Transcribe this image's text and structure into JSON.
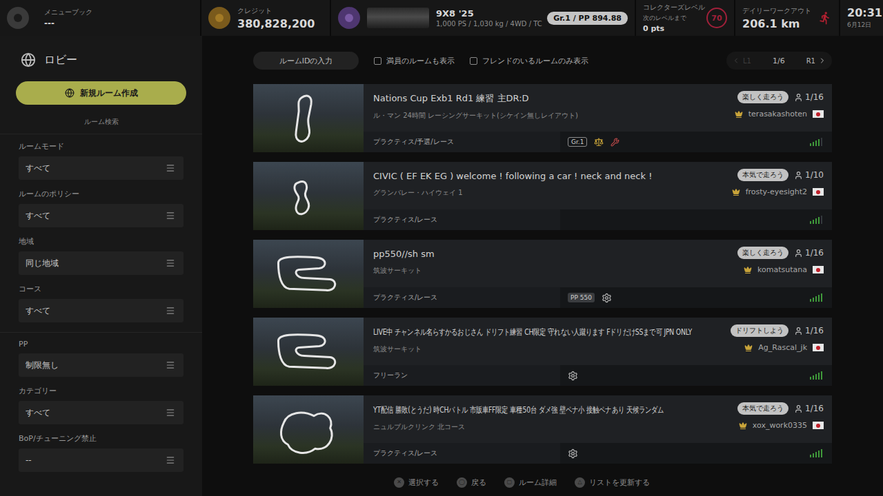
{
  "topbar": {
    "menu_book": {
      "label": "メニューブック",
      "value": "---"
    },
    "credits": {
      "label": "クレジット",
      "value": "380,828,200"
    },
    "car": {
      "name": "9X8 '25",
      "specs": "1,000 PS / 1,030 kg / 4WD / TC",
      "badge": "Gr.1 / PP 894.88"
    },
    "collector": {
      "label": "コレクターズレベル",
      "sublabel": "次のレベルまで",
      "points": "0 pts",
      "level": "70"
    },
    "workout": {
      "label": "デイリーワークアウト",
      "value": "206.1 km"
    },
    "clock": {
      "time": "20:31",
      "date": "6月12日"
    }
  },
  "sidebar": {
    "title": "ロビー",
    "create_button": "新規ルーム作成",
    "search_title": "ルーム検索",
    "filter_groups": [
      [
        {
          "label": "ルームモード",
          "value": "すべて"
        },
        {
          "label": "ルームのポリシー",
          "value": "すべて"
        },
        {
          "label": "地域",
          "value": "同じ地域"
        },
        {
          "label": "コース",
          "value": "すべて"
        }
      ],
      [
        {
          "label": "PP",
          "value": "制限無し"
        },
        {
          "label": "カテゴリー",
          "value": "すべて"
        },
        {
          "label": "BoP/チューニング禁止",
          "value": "--"
        }
      ]
    ]
  },
  "toolbar": {
    "room_id_button": "ルームIDの入力",
    "checkboxes": [
      {
        "label": "満員のルームも表示",
        "checked": false
      },
      {
        "label": "フレンドのいるルームのみ表示",
        "checked": false
      }
    ],
    "pager": {
      "prev": "L1",
      "prev_disabled": true,
      "page": "1/6",
      "next": "R1"
    }
  },
  "rooms": [
    {
      "title": "Nations Cup Exb1 Rd1 練習 主DR:D",
      "course": "ル・マン 24時間 レーシングサーキット(シケイン無しレイアウト)",
      "mode": "プラクティス/予選/レース",
      "policy": "楽しく走ろう",
      "players": "1/16",
      "host": "terasakashoten",
      "signal_bars": 4,
      "tags": [
        {
          "kind": "class-badge",
          "label": "Gr.1"
        },
        {
          "kind": "bop"
        },
        {
          "kind": "no-tuning"
        }
      ]
    },
    {
      "title": "CIVIC ( EF EK EG ) welcome ! following a car ! neck and neck !",
      "course": "グランバレー・ハイウェイ 1",
      "mode": "プラクティス/レース",
      "policy": "本気で走ろう",
      "players": "1/10",
      "host": "frosty-eyesight2",
      "signal_bars": 4,
      "tags": []
    },
    {
      "title": "pp550//sh  sm",
      "course": "筑波サーキット",
      "mode": "プラクティス/レース",
      "policy": "楽しく走ろう",
      "players": "1/16",
      "host": "komatsutana",
      "signal_bars": 5,
      "tags": [
        {
          "kind": "pp-badge",
          "label": "PP 550"
        },
        {
          "kind": "settings"
        }
      ]
    },
    {
      "title": "LIVE中 チャンネル名らすかるおじさん ドリフト練習 CH限定 守れない人蹴ります FドリだけSSまで可 JPN ONLY",
      "course": "筑波サーキット",
      "mode": "フリーラン",
      "policy": "ドリフトしよう",
      "players": "1/16",
      "host": "Ag_Rascal_jk",
      "signal_bars": 5,
      "tags": [
        {
          "kind": "settings"
        }
      ]
    },
    {
      "title": "YT配信 勝敗(とうだ) 時CHバトル 市販車FF限定 車種50台 ダメ強 壁ペナ小 接触ペナあり 天候ランダム",
      "course": "ニュルブルクリンク 北コース",
      "mode": "プラクティス/レース",
      "policy": "本気で走ろう",
      "players": "1/16",
      "host": "xox_work0335",
      "signal_bars": 5,
      "tags": [
        {
          "kind": "settings"
        }
      ]
    }
  ],
  "hints": [
    {
      "button": "✕",
      "label": "選択する"
    },
    {
      "button": "◯",
      "label": "戻る"
    },
    {
      "button": "▢",
      "label": "ルーム詳細"
    },
    {
      "button": "△",
      "label": "リストを更新する"
    }
  ]
}
